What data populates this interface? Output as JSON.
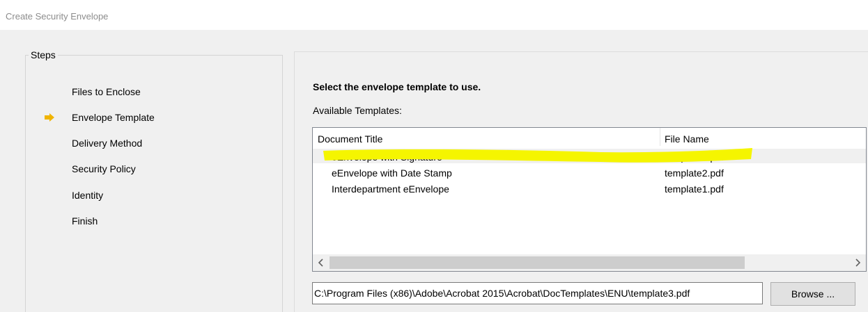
{
  "window": {
    "title": "Create Security Envelope"
  },
  "steps": {
    "legend": "Steps",
    "items": [
      {
        "label": "Files to Enclose",
        "current": false
      },
      {
        "label": "Envelope Template",
        "current": true
      },
      {
        "label": "Delivery Method",
        "current": false
      },
      {
        "label": "Security Policy",
        "current": false
      },
      {
        "label": "Identity",
        "current": false
      },
      {
        "label": "Finish",
        "current": false
      }
    ],
    "arrow_color": "#f0b400"
  },
  "main": {
    "heading": "Select the envelope template to use.",
    "available_label": "Available Templates:",
    "columns": {
      "title": "Document Title",
      "file": "File Name"
    },
    "rows": [
      {
        "title": "eEnvelope with Signature",
        "file": "template3.pdf",
        "selected": true
      },
      {
        "title": "eEnvelope with Date Stamp",
        "file": "template2.pdf",
        "selected": false
      },
      {
        "title": "Interdepartment eEnvelope",
        "file": "template1.pdf",
        "selected": false
      }
    ],
    "highlight_color": "#f5f500",
    "path_value": "C:\\Program Files (x86)\\Adobe\\Acrobat 2015\\Acrobat\\DocTemplates\\ENU\\template3.pdf",
    "browse_label": "Browse ..."
  }
}
